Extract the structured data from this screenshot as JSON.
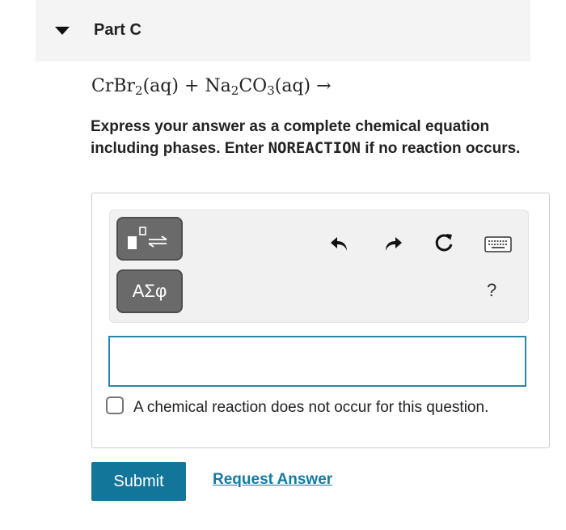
{
  "part": {
    "title": "Part C"
  },
  "equation": {
    "cr": "CrBr",
    "cr_sub": "2",
    "aq1": "(aq) + ",
    "na": "Na",
    "na_sub": "2",
    "co": "CO",
    "co_sub": "3",
    "aq2": "(aq) →"
  },
  "instruction": {
    "before": "Express your answer as a complete chemical equation including phases. Enter ",
    "code": "NOREACTION",
    "after": " if no reaction occurs."
  },
  "toolbar": {
    "symbols_label": "ΑΣφ",
    "help_label": "?",
    "icons": [
      "templates-icon",
      "undo-icon",
      "redo-icon",
      "reset-icon",
      "keyboard-icon"
    ]
  },
  "answer": {
    "value": "",
    "placeholder": ""
  },
  "checkbox": {
    "label": "A chemical reaction does not occur for this question.",
    "checked": false
  },
  "actions": {
    "submit_label": "Submit",
    "request_label": "Request Answer"
  },
  "colors": {
    "accent": "#12769a",
    "link": "#167aa0",
    "input_border": "#2b87a8",
    "tool_button": "#6a6a6a"
  }
}
